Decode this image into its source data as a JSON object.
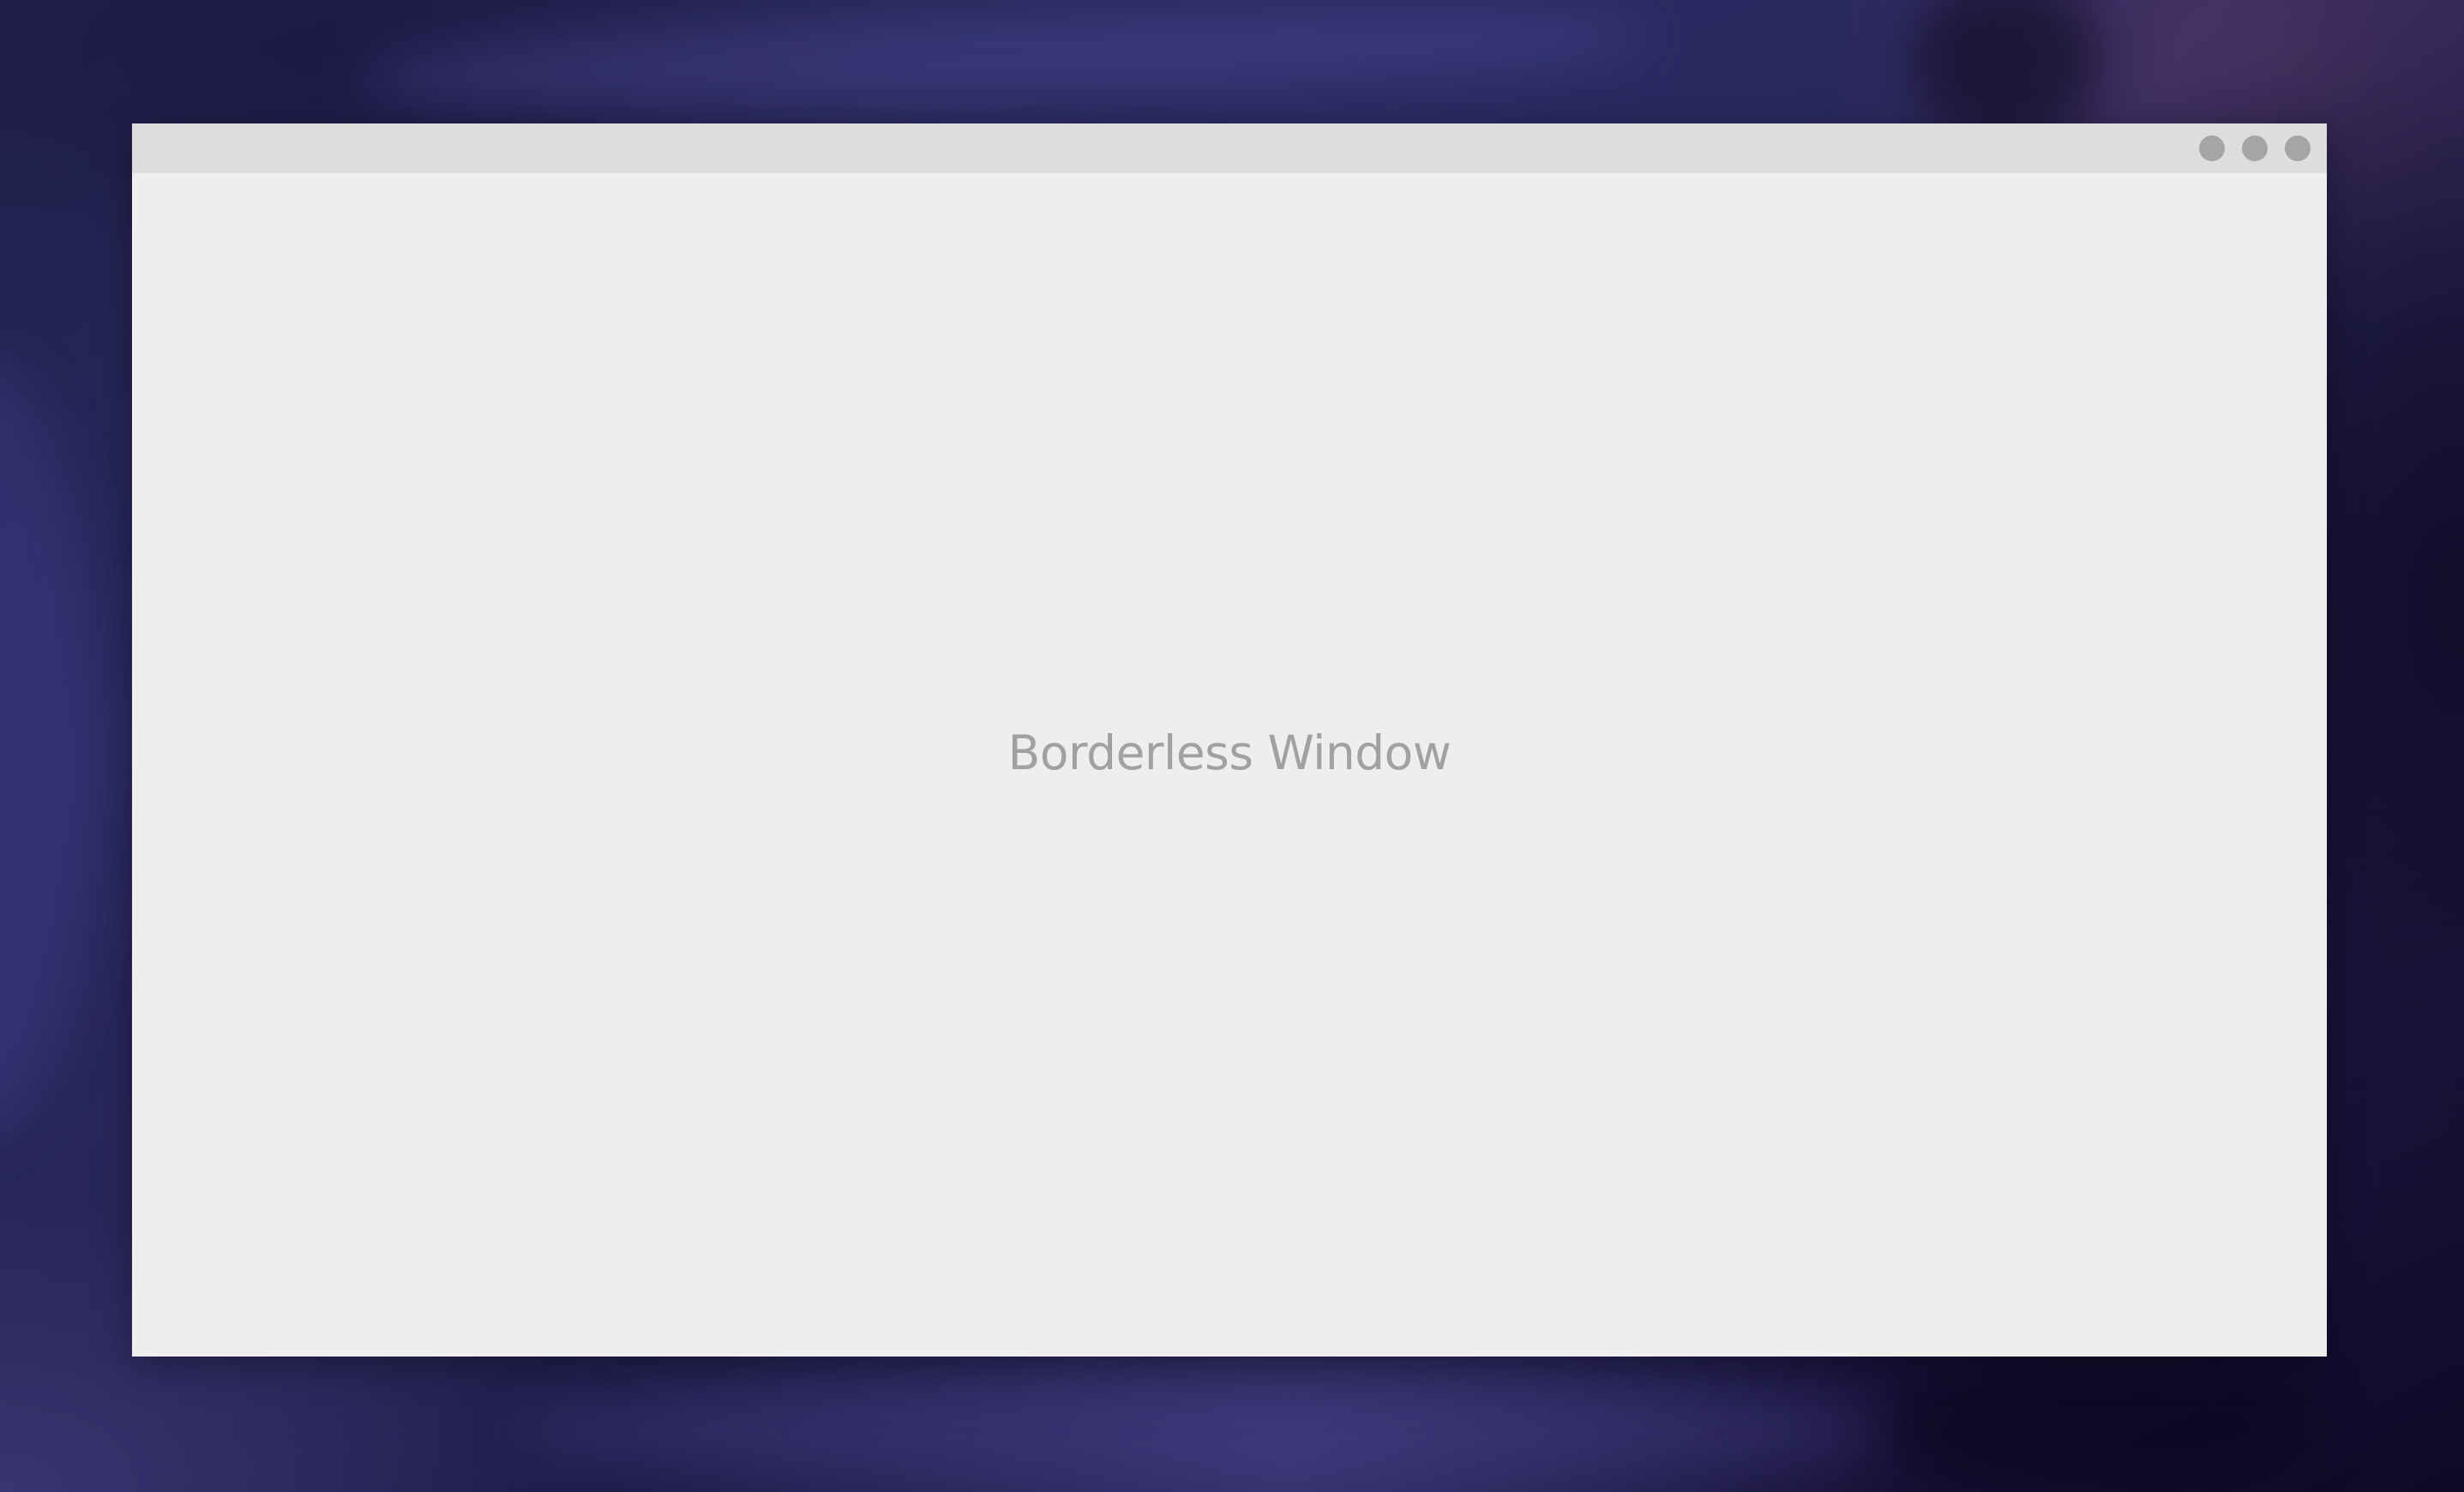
{
  "window": {
    "title_bar": {
      "controls": [
        {
          "name": "minimize",
          "icon": "circle-icon"
        },
        {
          "name": "maximize",
          "icon": "circle-icon"
        },
        {
          "name": "close",
          "icon": "circle-icon"
        }
      ]
    },
    "content": {
      "text": "Borderless Window"
    }
  },
  "colors": {
    "window_background": "#eeeeee",
    "title_bar_background": "#dddddd",
    "control_color": "#a5a5a5",
    "text_color": "#a1a1a1"
  }
}
